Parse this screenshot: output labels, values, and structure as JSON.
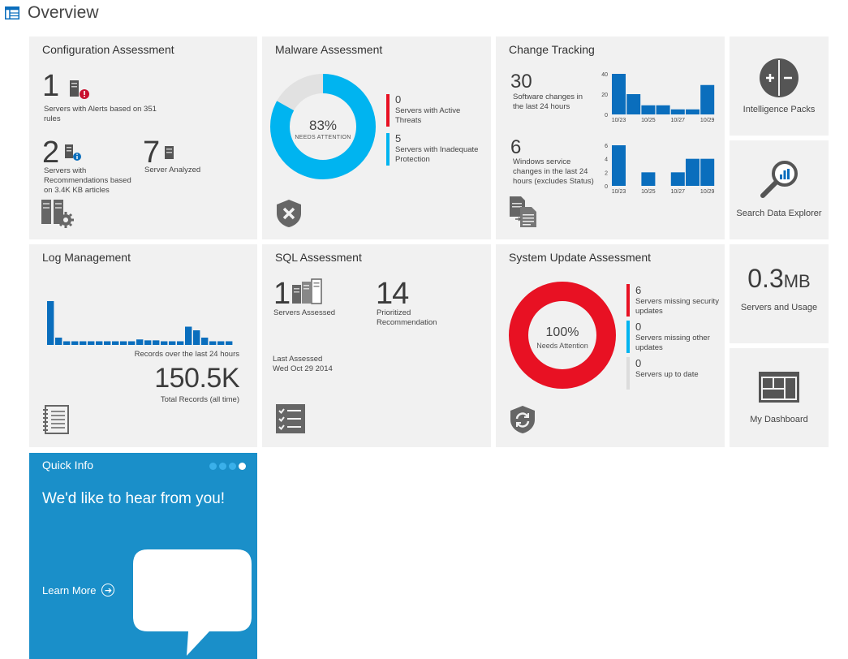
{
  "page": {
    "title": "Overview"
  },
  "tiles": {
    "config": {
      "title": "Configuration Assessment",
      "alerts_count": "1",
      "alerts_label": "Servers with Alerts based on 351 rules",
      "recs_count": "2",
      "recs_label": "Servers with Recommendations based on 3.4K KB articles",
      "analyzed_count": "7",
      "analyzed_label": "Server Analyzed"
    },
    "malware": {
      "title": "Malware Assessment",
      "donut_percent": 83,
      "donut_value": "83%",
      "donut_label": "NEEDS ATTENTION",
      "legend": [
        {
          "count": "0",
          "label": "Servers with Active Threats",
          "color": "#e81123"
        },
        {
          "count": "5",
          "label": "Servers with Inadequate Protection",
          "color": "#00b4f0"
        }
      ],
      "colors": {
        "primary": "#00b4f0",
        "rest": "#e1e1e1"
      }
    },
    "change": {
      "title": "Change Tracking",
      "software_count": "30",
      "software_label": "Software changes in the last 24 hours",
      "windows_count": "6",
      "windows_label": "Windows service changes in the last 24 hours (excludes Status)"
    },
    "intelligence": {
      "label": "Intelligence Packs"
    },
    "search": {
      "label": "Search Data Explorer"
    },
    "log": {
      "title": "Log Management",
      "chart_label": "Records over the last 24 hours",
      "total_value": "150.5K",
      "total_label": "Total Records (all time)"
    },
    "sql": {
      "title": "SQL Assessment",
      "servers_count": "1",
      "servers_label": "Servers Assessed",
      "prioritized_count": "14",
      "prioritized_label": "Prioritized Recommendation",
      "last_label": "Last Assessed",
      "last_date": "Wed Oct 29 2014"
    },
    "sysupdate": {
      "title": "System Update Assessment",
      "donut_percent": 100,
      "donut_value": "100%",
      "donut_label": "Needs Attention",
      "legend": [
        {
          "count": "6",
          "label": "Servers missing security updates",
          "color": "#e81123"
        },
        {
          "count": "0",
          "label": "Servers missing other updates",
          "color": "#00b4f0"
        },
        {
          "count": "0",
          "label": "Servers up to date",
          "color": "#dcdcdc"
        }
      ],
      "colors": {
        "primary": "#e81123",
        "rest": "#e1e1e1"
      }
    },
    "usage": {
      "value": "0.3",
      "unit": "MB",
      "label": "Servers and Usage"
    },
    "dashboard": {
      "label": "My Dashboard"
    },
    "quickinfo": {
      "title": "Quick Info",
      "headline": "We'd like to hear from you!",
      "link": "Learn More",
      "dots": 4,
      "active_dot": 3
    }
  },
  "chart_data": [
    {
      "type": "bar",
      "id": "software",
      "categories": [
        "10/23",
        "",
        "10/25",
        "",
        "10/27",
        "",
        "10/29"
      ],
      "values": [
        40,
        20,
        9,
        9,
        5,
        5,
        29
      ],
      "ylim": [
        0,
        40
      ],
      "yticks": [
        0,
        20,
        40
      ],
      "color": "#0a6ebd"
    },
    {
      "type": "bar",
      "id": "windows",
      "categories": [
        "10/23",
        "",
        "10/25",
        "",
        "10/27",
        "",
        "10/29"
      ],
      "values": [
        6,
        0,
        2,
        0,
        2,
        4,
        4
      ],
      "ylim": [
        0,
        6
      ],
      "yticks": [
        0,
        2,
        4,
        6
      ],
      "color": "#0a6ebd"
    },
    {
      "type": "bar",
      "id": "log",
      "values": [
        48,
        8,
        4,
        4,
        4,
        4,
        4,
        4,
        4,
        4,
        4,
        6,
        5,
        5,
        4,
        4,
        4,
        20,
        16,
        8,
        4,
        4,
        4
      ],
      "color": "#0a6ebd"
    }
  ]
}
